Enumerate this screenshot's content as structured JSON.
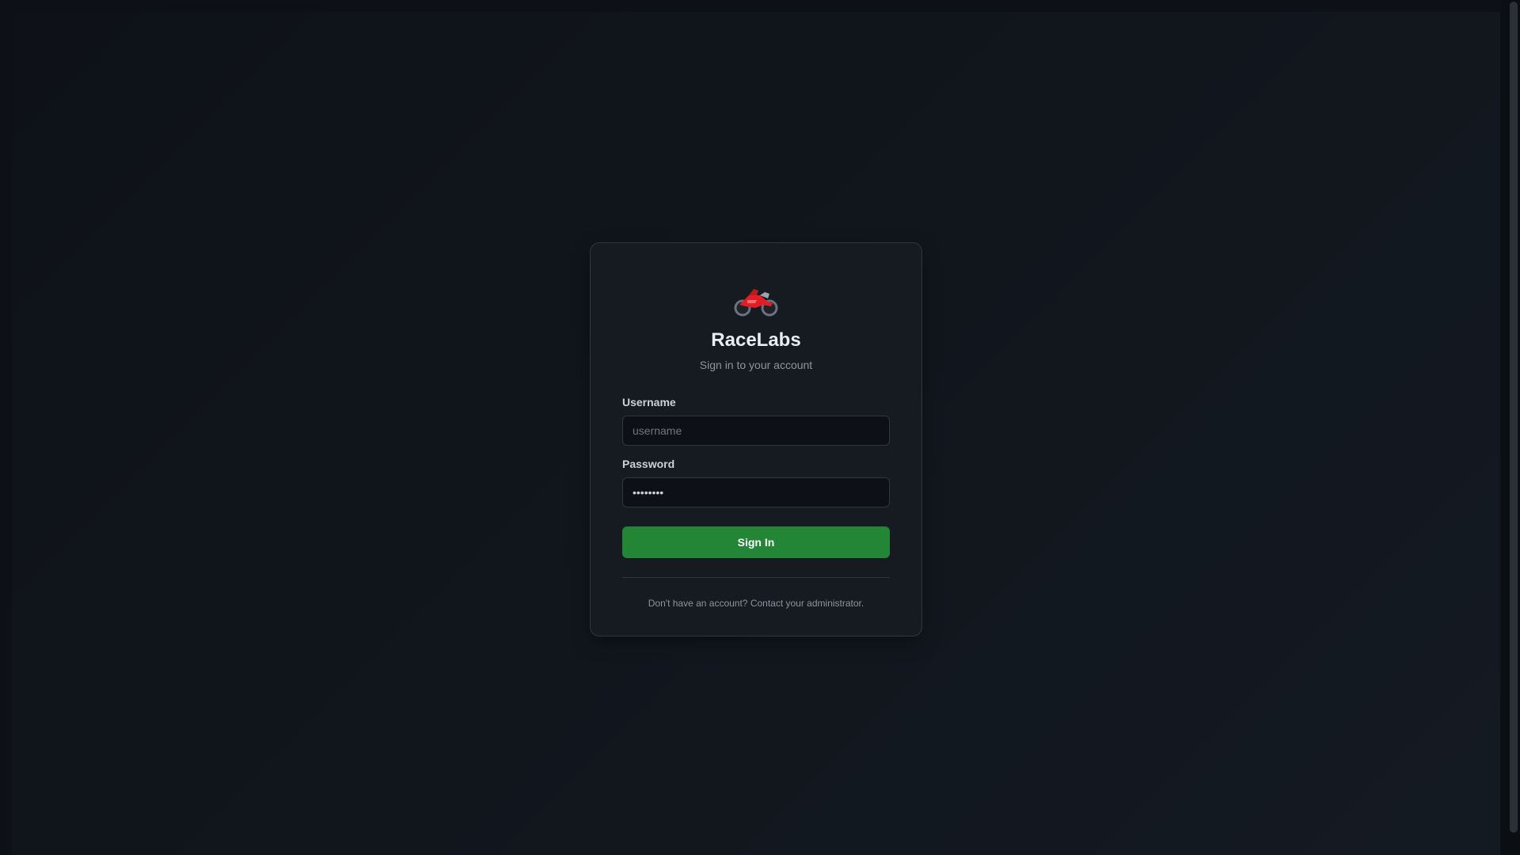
{
  "app": {
    "title": "RaceLabs",
    "subtitle": "Sign in to your account",
    "logo_icon": "motorcycle-icon"
  },
  "form": {
    "username_label": "Username",
    "username_placeholder": "username",
    "password_label": "Password",
    "password_value": "••••••••",
    "submit_label": "Sign In"
  },
  "footer": {
    "text": "Don't have an account? Contact your administrator."
  },
  "colors": {
    "background": "#0d1117",
    "card": "#161b22",
    "border": "#30363d",
    "accent_green": "#238636",
    "logo_red": "#e11d26"
  }
}
